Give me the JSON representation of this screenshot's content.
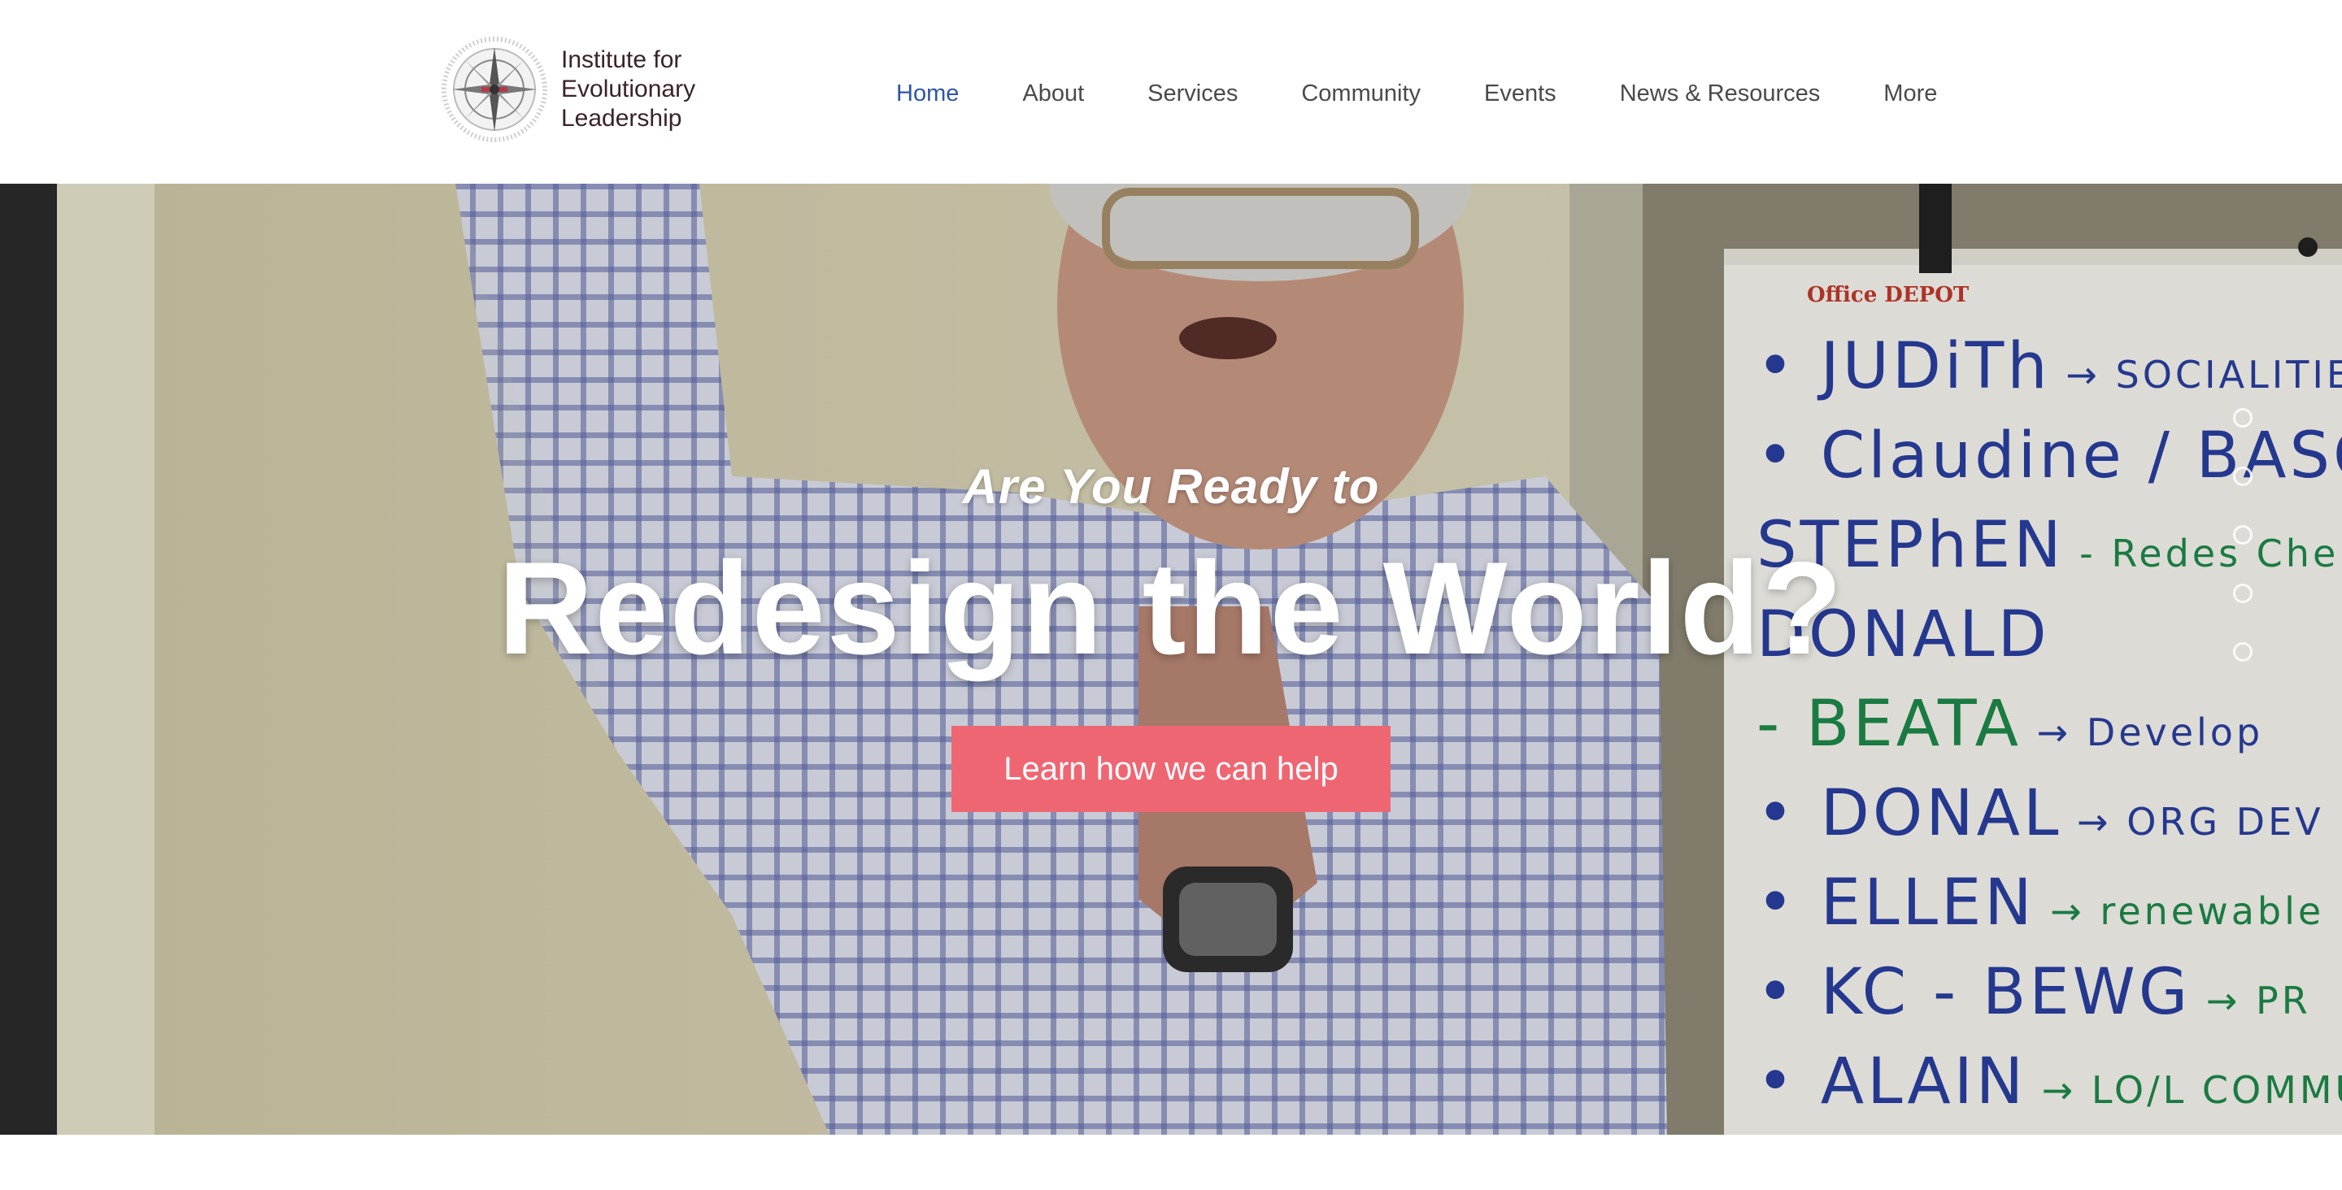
{
  "brand": {
    "line1": "Institute for",
    "line2": "Evolutionary",
    "line3": "Leadership",
    "logo_icon": "compass-rose-icon",
    "logo_color": "#7a2f3a"
  },
  "nav": {
    "items": [
      {
        "label": "Home",
        "active": true
      },
      {
        "label": "About"
      },
      {
        "label": "Services"
      },
      {
        "label": "Community"
      },
      {
        "label": "Events"
      },
      {
        "label": "News & Resources"
      },
      {
        "label": "More"
      }
    ],
    "active_color": "#2f55a4",
    "text_color": "#4a4a4a"
  },
  "hero": {
    "kicker": "Are You Ready to",
    "headline": "Redesign the World?",
    "cta_label": "Learn how we can help",
    "cta_color": "#ef6673",
    "slide_count": 5
  },
  "flipchart": {
    "brand": "Office DEPOT",
    "lines": [
      {
        "text": "• JUDiTh",
        "annotation": "→ SOCIALITIES",
        "color": "#2a3fa0",
        "ann_color": "#2a3fa0"
      },
      {
        "text": "• Claudine / BASOL",
        "annotation": "",
        "color": "#2a3fa0",
        "ann_color": "#2a3fa0"
      },
      {
        "text": "STEPhEN",
        "annotation": "- Redes Che",
        "color": "#2a3fa0",
        "ann_color": "#1e8a4a"
      },
      {
        "text": "DONALD",
        "annotation": "",
        "color": "#2a3fa0",
        "ann_color": "#2a3fa0"
      },
      {
        "text": "- BEATA",
        "annotation": "→ Develop",
        "color": "#1e8a4a",
        "ann_color": "#2a3fa0"
      },
      {
        "text": "• DONAL",
        "annotation": "→ ORG DEV",
        "color": "#2a3fa0",
        "ann_color": "#2a3fa0"
      },
      {
        "text": "• ELLEN",
        "annotation": "→ renewable",
        "color": "#2a3fa0",
        "ann_color": "#1e8a4a"
      },
      {
        "text": "• KC - BEWG",
        "annotation": "→ PR",
        "color": "#2a3fa0",
        "ann_color": "#1e8a4a"
      },
      {
        "text": "• ALAIN",
        "annotation": "→ LO/L COMMUNITY",
        "color": "#2a3fa0",
        "ann_color": "#1e8a4a"
      }
    ]
  }
}
